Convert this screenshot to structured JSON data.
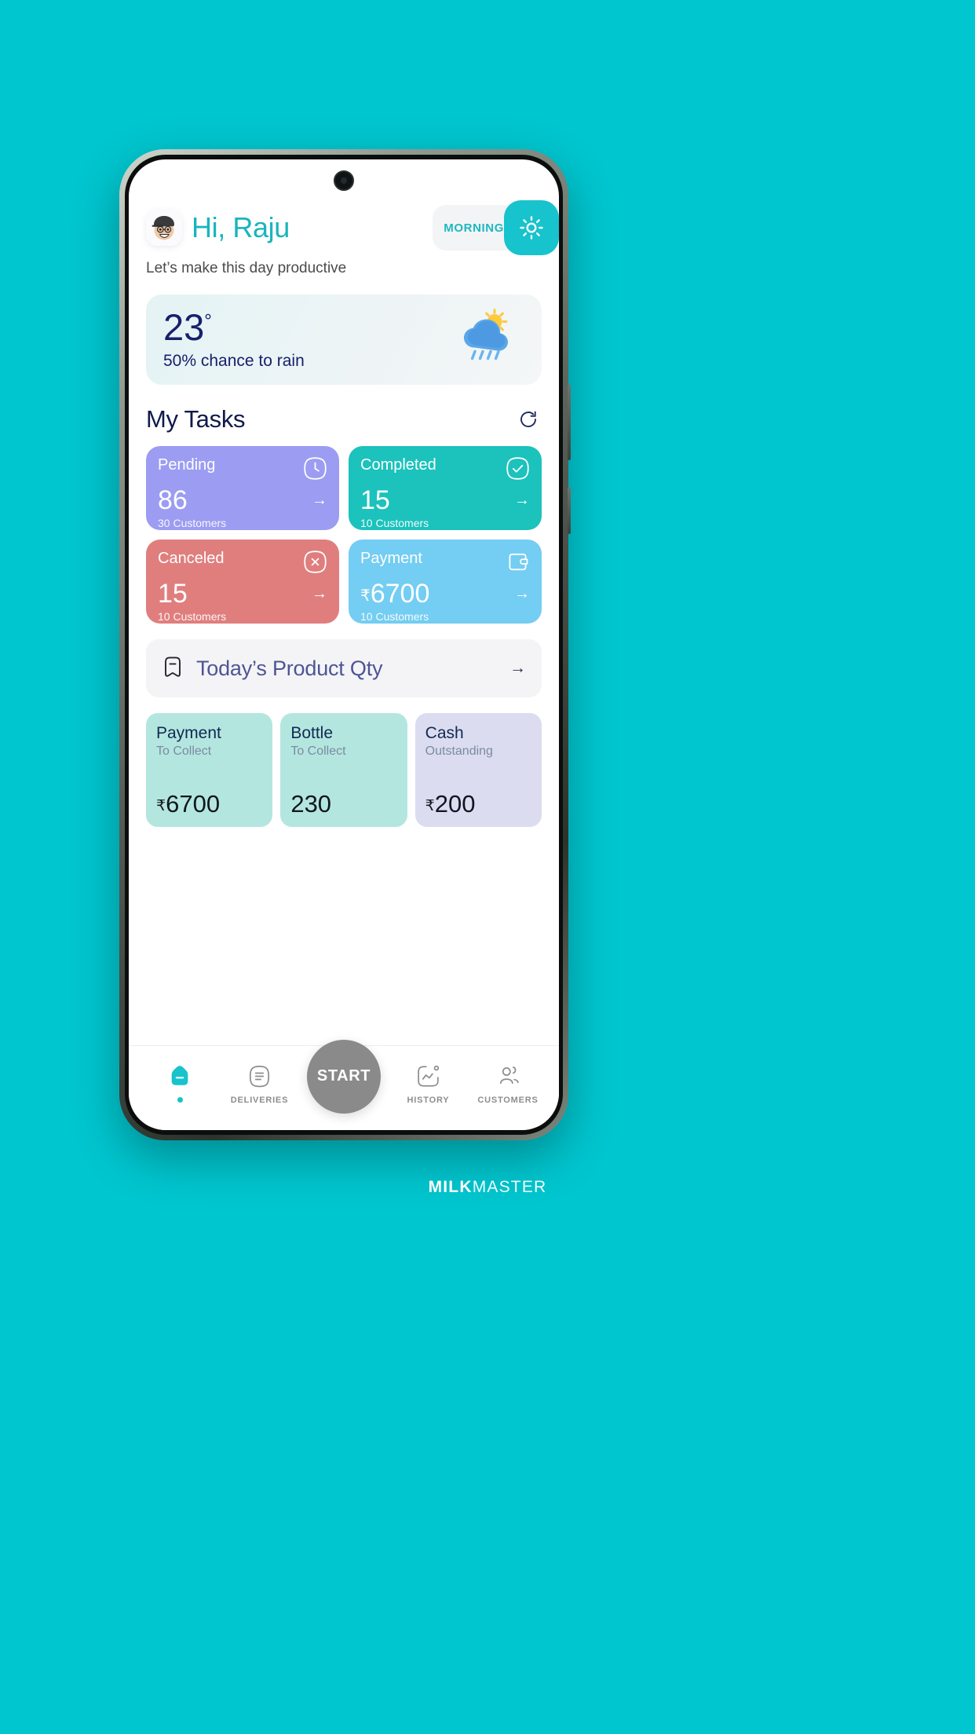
{
  "brand": {
    "bold": "MILK",
    "light": "MASTER"
  },
  "header": {
    "avatar_emoji": "🧑🏽‍🦰",
    "greeting": "Hi, Raju",
    "daypart": "MORNING",
    "sun_icon": "sun-icon",
    "subtitle": "Let’s make this day productive"
  },
  "weather": {
    "temperature": "23",
    "degree": "°",
    "rain_text": "50% chance to rain",
    "icon": "sun-behind-rain-cloud-icon"
  },
  "tasks": {
    "section_title": "My Tasks",
    "refresh_icon": "refresh-icon",
    "cards": [
      {
        "label": "Pending",
        "value": "86",
        "currency": "",
        "customers": "30 Customers",
        "icon": "clock-icon",
        "color": "#9b9cf2",
        "arrow": "→"
      },
      {
        "label": "Completed",
        "value": "15",
        "currency": "",
        "customers": "10 Customers",
        "icon": "check-icon",
        "color": "#1cc2bc",
        "arrow": "→"
      },
      {
        "label": "Canceled",
        "value": "15",
        "currency": "",
        "customers": "10 Customers",
        "icon": "close-icon",
        "color": "#e07e7e",
        "arrow": "→"
      },
      {
        "label": "Payment",
        "value": "6700",
        "currency": "₹",
        "customers": "10 Customers",
        "icon": "wallet-icon",
        "color": "#74cdf2",
        "arrow": "→"
      }
    ]
  },
  "product_row": {
    "icon": "bookmark-minus-icon",
    "title": "Today’s Product Qty",
    "arrow": "→"
  },
  "stats": [
    {
      "title": "Payment",
      "subtitle": "To Collect",
      "currency": "₹",
      "value": "6700",
      "bg": "#b4e6e0"
    },
    {
      "title": "Bottle",
      "subtitle": "To Collect",
      "currency": "",
      "value": "230",
      "bg": "#b4e6e0"
    },
    {
      "title": "Cash",
      "subtitle": "Outstanding",
      "currency": "₹",
      "value": "200",
      "bg": "#dcdcf0"
    }
  ],
  "bottom_nav": {
    "items": [
      {
        "label": "",
        "icon": "home-icon",
        "active": true
      },
      {
        "label": "DELIVERIES",
        "icon": "document-icon",
        "active": false
      },
      {
        "label": "HISTORY",
        "icon": "chart-icon",
        "active": false
      },
      {
        "label": "CUSTOMERS",
        "icon": "people-icon",
        "active": false
      }
    ],
    "start_label": "START"
  },
  "colors": {
    "page_background": "#00c6cf",
    "accent_teal": "#17c3cc",
    "navy": "#17206b",
    "title_navy": "#101a4b"
  }
}
